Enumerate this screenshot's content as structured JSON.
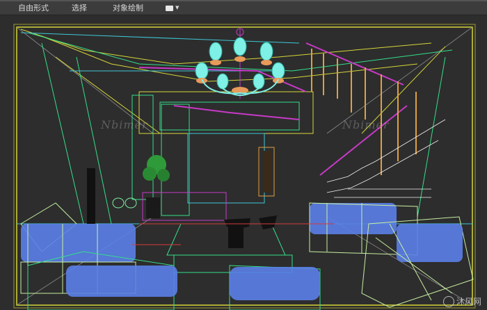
{
  "toolbar": {
    "freeform_label": "自由形式",
    "select_label": "选择",
    "object_paint_label": "对象绘制"
  },
  "icons": {
    "viewport_menu": "viewport-shading-icon",
    "caret": "chevron-down-icon"
  },
  "viewport": {
    "mode": "wireframe",
    "background": "#2d2d2d",
    "wire_colors": [
      "#d6d63a",
      "#34e08a",
      "#3ec8d8",
      "#c83ac8",
      "#e0a040",
      "#f0f0f0",
      "#6ea8ff"
    ]
  },
  "watermark": {
    "left_text": "Nbimer",
    "center_text": "Nbimer",
    "bottom_text": "沐风网"
  }
}
